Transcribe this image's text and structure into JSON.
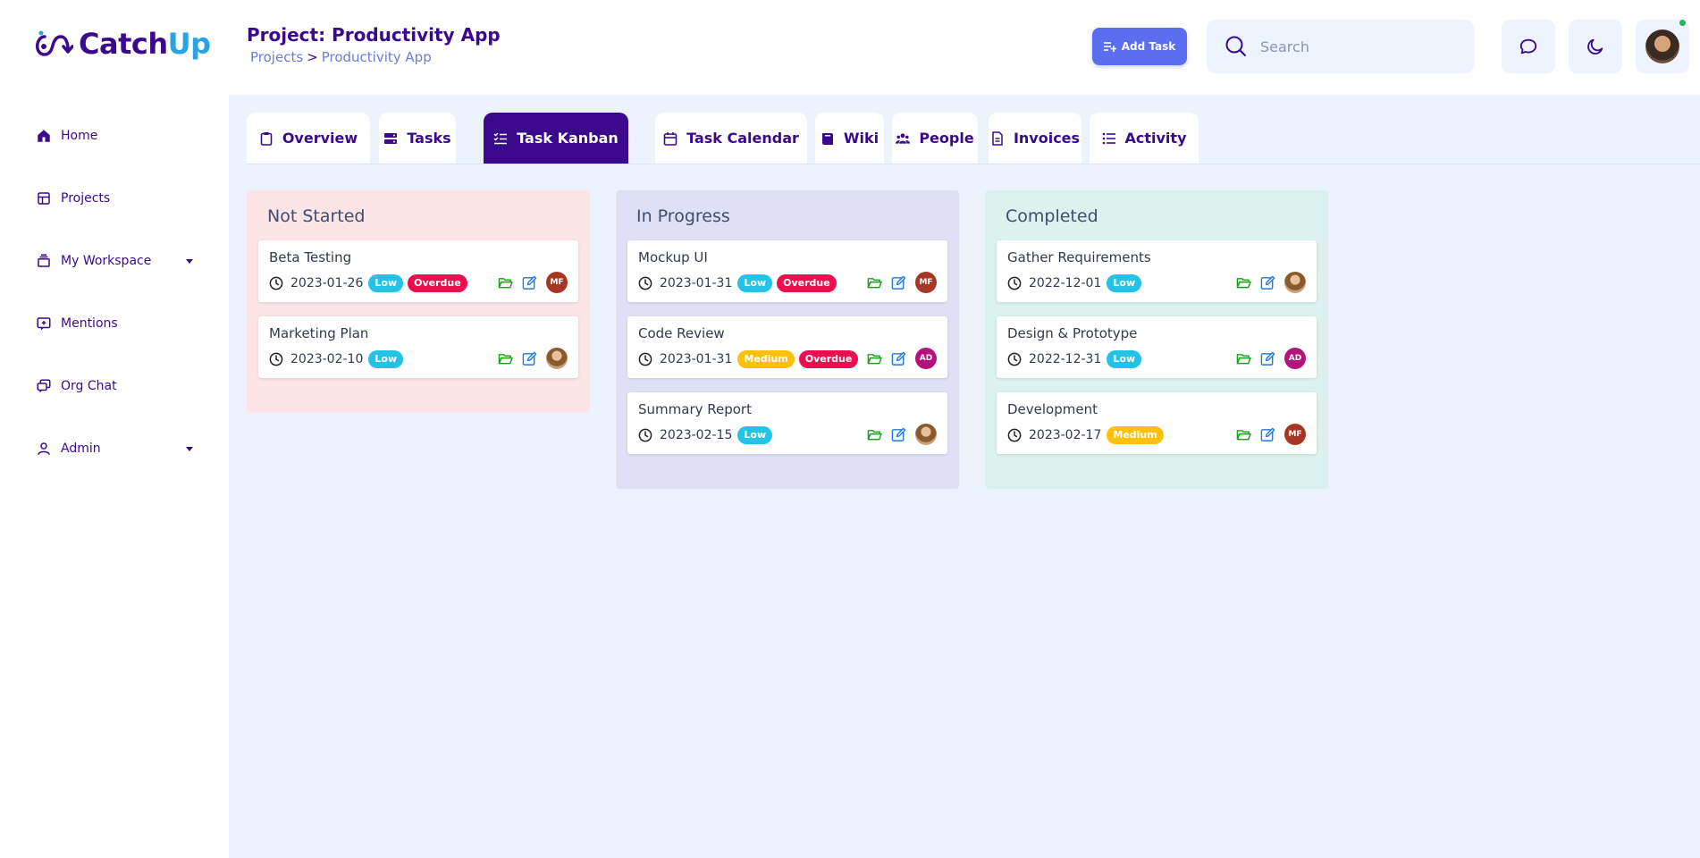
{
  "brand": {
    "name_part1": "Catch",
    "name_part2": "Up"
  },
  "sidebar": {
    "items": [
      {
        "label": "Home",
        "icon": "home-icon"
      },
      {
        "label": "Projects",
        "icon": "projects-icon"
      },
      {
        "label": "My Workspace",
        "icon": "workspace-icon",
        "has_dropdown": true
      },
      {
        "label": "Mentions",
        "icon": "mentions-icon"
      },
      {
        "label": "Org Chat",
        "icon": "chat-icon"
      },
      {
        "label": "Admin",
        "icon": "user-icon",
        "has_dropdown": true
      }
    ]
  },
  "header": {
    "title": "Project: Productivity App",
    "breadcrumb": {
      "root": "Projects",
      "separator": ">",
      "current": "Productivity App"
    },
    "add_task_label": "Add Task",
    "search_placeholder": "Search"
  },
  "tabs": [
    {
      "label": "Overview",
      "icon": "clipboard-icon"
    },
    {
      "label": "Tasks",
      "icon": "tasks-icon"
    },
    {
      "label": "Task Kanban",
      "icon": "checklist-icon",
      "active": true
    },
    {
      "label": "Task Calendar",
      "icon": "calendar-icon"
    },
    {
      "label": "Wiki",
      "icon": "book-icon"
    },
    {
      "label": "People",
      "icon": "people-icon"
    },
    {
      "label": "Invoices",
      "icon": "invoice-icon"
    },
    {
      "label": "Activity",
      "icon": "list-icon"
    }
  ],
  "columns": [
    {
      "title": "Not Started",
      "color": "#fde4e6",
      "cards": [
        {
          "title": "Beta Testing",
          "date": "2023-01-26",
          "priority": "Low",
          "overdue": "Overdue",
          "assignee": "MF"
        },
        {
          "title": "Marketing Plan",
          "date": "2023-02-10",
          "priority": "Low",
          "assignee": "photo"
        }
      ]
    },
    {
      "title": "In Progress",
      "color": "#dfe0f5",
      "cards": [
        {
          "title": "Mockup UI",
          "date": "2023-01-31",
          "priority": "Low",
          "overdue": "Overdue",
          "assignee": "MF"
        },
        {
          "title": "Code Review",
          "date": "2023-01-31",
          "priority": "Medium",
          "overdue": "Overdue",
          "assignee": "AD"
        },
        {
          "title": "Summary Report",
          "date": "2023-02-15",
          "priority": "Low",
          "assignee": "photo"
        }
      ]
    },
    {
      "title": "Completed",
      "color": "#dcf2ee",
      "cards": [
        {
          "title": "Gather Requirements",
          "date": "2022-12-01",
          "priority": "Low",
          "assignee": "photo"
        },
        {
          "title": "Design & Prototype",
          "date": "2022-12-31",
          "priority": "Low",
          "assignee": "AD"
        },
        {
          "title": "Development",
          "date": "2023-02-17",
          "priority": "Medium",
          "assignee": "MF"
        }
      ]
    }
  ],
  "colors": {
    "primary": "#3b0a8c",
    "accent": "#5b6ef0",
    "low": "#22c3e6",
    "medium": "#ffc107",
    "overdue": "#ec0e4f"
  }
}
